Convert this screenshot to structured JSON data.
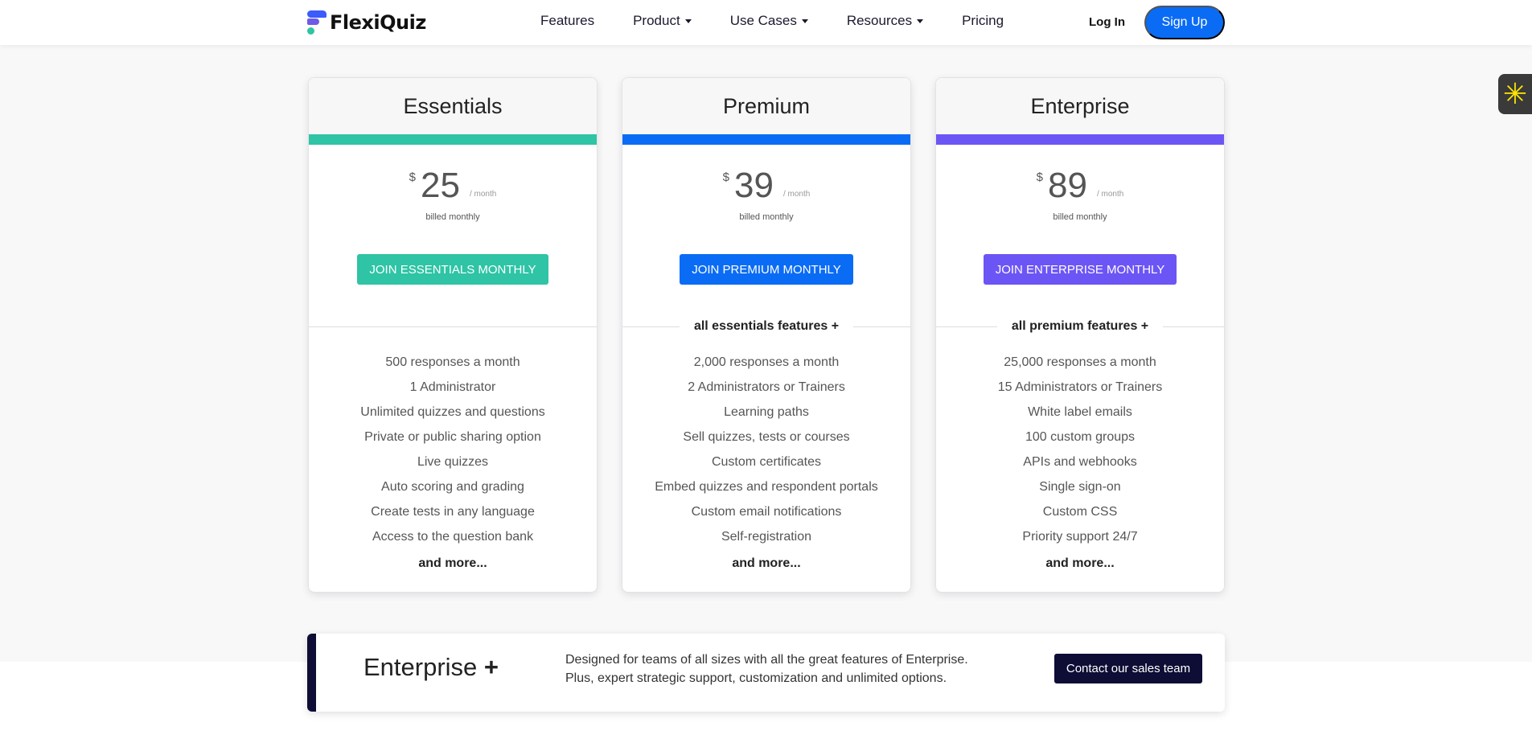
{
  "header": {
    "logo_text": "FlexiQuiz",
    "nav": [
      {
        "label": "Features",
        "dropdown": false
      },
      {
        "label": "Product",
        "dropdown": true
      },
      {
        "label": "Use Cases",
        "dropdown": true
      },
      {
        "label": "Resources",
        "dropdown": true
      },
      {
        "label": "Pricing",
        "dropdown": false
      }
    ],
    "login": "Log In",
    "signup": "Sign Up"
  },
  "side_widget": {
    "icon": "asterisk-icon",
    "glyph": "✳"
  },
  "plans": [
    {
      "name": "Essentials",
      "accent": "#2ec4a5",
      "currency": "$",
      "price": "25",
      "period": "/ month",
      "billed": "billed monthly",
      "button": "JOIN ESSENTIALS MONTHLY",
      "includes": "",
      "features": [
        "500 responses a month",
        "1 Administrator",
        "Unlimited quizzes and questions",
        "Private or public sharing option",
        "Live quizzes",
        "Auto scoring and grading",
        "Create tests in any language",
        "Access to the question bank"
      ],
      "more": "and more..."
    },
    {
      "name": "Premium",
      "accent": "#0a6cf5",
      "currency": "$",
      "price": "39",
      "period": "/ month",
      "billed": "billed monthly",
      "button": "JOIN PREMIUM MONTHLY",
      "includes": "all essentials features +",
      "features": [
        "2,000 responses a month",
        "2 Administrators or Trainers",
        "Learning paths",
        "Sell quizzes, tests or courses",
        "Custom certificates",
        "Embed quizzes and respondent portals",
        "Custom email notifications",
        "Self-registration"
      ],
      "more": "and more..."
    },
    {
      "name": "Enterprise",
      "accent": "#6c55f5",
      "currency": "$",
      "price": "89",
      "period": "/ month",
      "billed": "billed monthly",
      "button": "JOIN ENTERPRISE MONTHLY",
      "includes": "all premium features +",
      "features": [
        "25,000 responses a month",
        "15 Administrators or Trainers",
        "White label emails",
        "100 custom groups",
        "APIs and webhooks",
        "Single sign-on",
        "Custom CSS",
        "Priority support 24/7"
      ],
      "more": "and more..."
    }
  ],
  "enterprise_plus": {
    "title": "Enterprise",
    "plus": "+",
    "desc_line1": "Designed for teams of all sizes with all the great features of Enterprise.",
    "desc_line2": "Plus, expert strategic support, customization and unlimited options.",
    "button": "Contact our sales team",
    "accent": "#0d0d35"
  }
}
